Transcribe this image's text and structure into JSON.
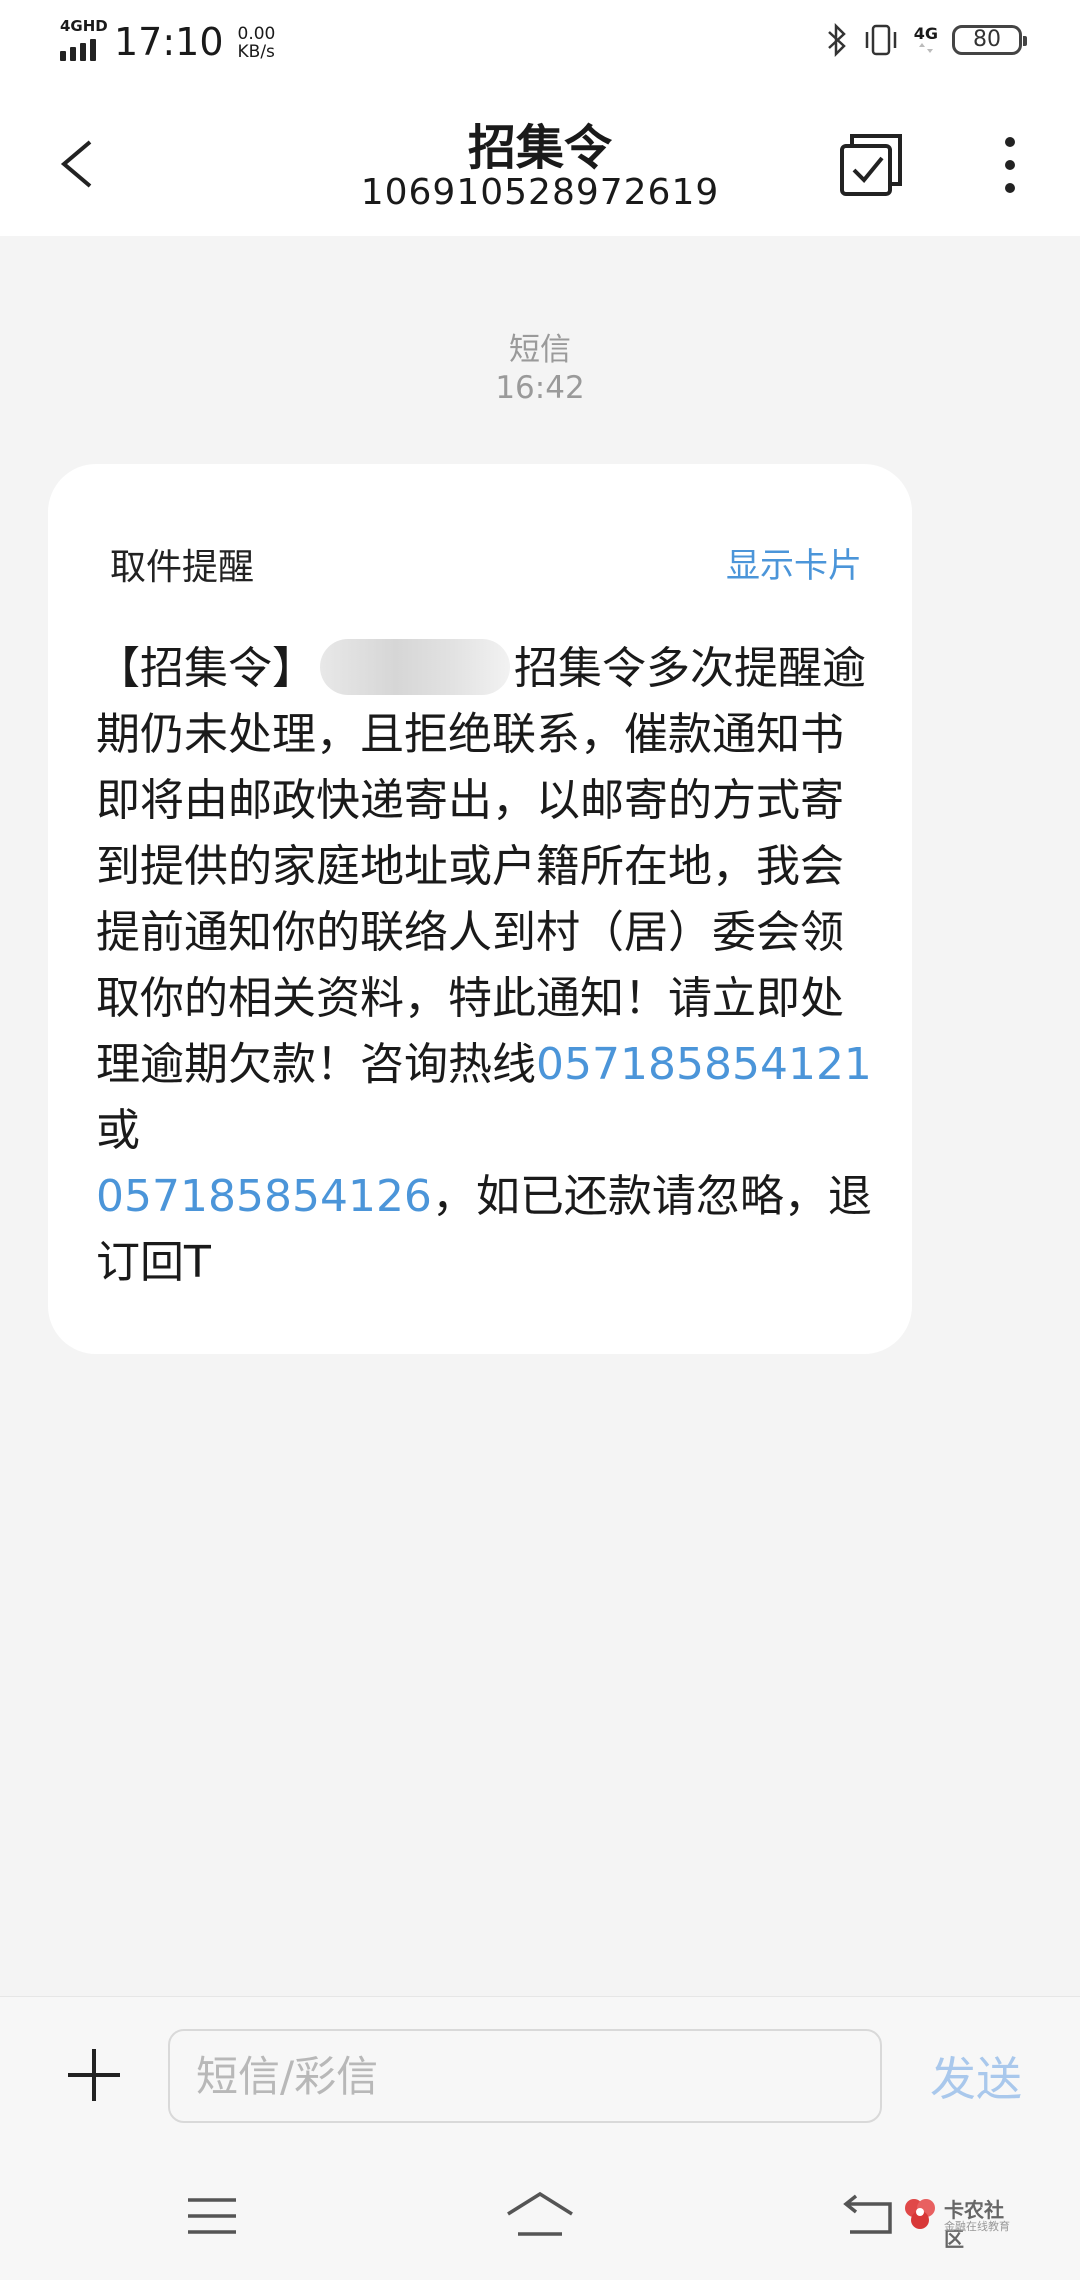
{
  "status_bar": {
    "network": "4GHD",
    "time": "17:10",
    "speed_value": "0.00",
    "speed_unit": "KB/s",
    "network_right": "4G",
    "battery": "80"
  },
  "header": {
    "title": "招集令",
    "subtitle": "106910528972619"
  },
  "message": {
    "type_label": "短信",
    "time": "16:42",
    "card_label": "取件提醒",
    "card_toggle": "显示卡片",
    "body_prefix": "【招集令】",
    "body_main": "招集令多次提醒逾期仍未处理，且拒绝联系，催款通知书即将由邮政快递寄出，以邮寄的方式寄到提供的家庭地址或户籍所在地，我会提前通知你的联络人到村（居）委会领取你的相关资料，特此通知！请立即处理逾期欠款！咨询热线",
    "phone_1": "057185854121",
    "connector": "或",
    "phone_2": "057185854126",
    "body_suffix": "，如已还款请忽略，退订回T"
  },
  "input_bar": {
    "placeholder": "短信/彩信",
    "send_label": "发送"
  },
  "watermark": {
    "title": "卡农社区",
    "subtitle": "金融在线教育"
  },
  "icons": {
    "back": "back-arrow-icon",
    "check": "multi-select-icon",
    "more": "more-vertical-icon",
    "plus": "plus-icon",
    "menu": "menu-icon",
    "home": "home-icon",
    "return": "return-icon"
  },
  "colors": {
    "accent": "#4b95d9",
    "send_disabled": "#a9c8ec",
    "background": "#f4f4f4"
  }
}
